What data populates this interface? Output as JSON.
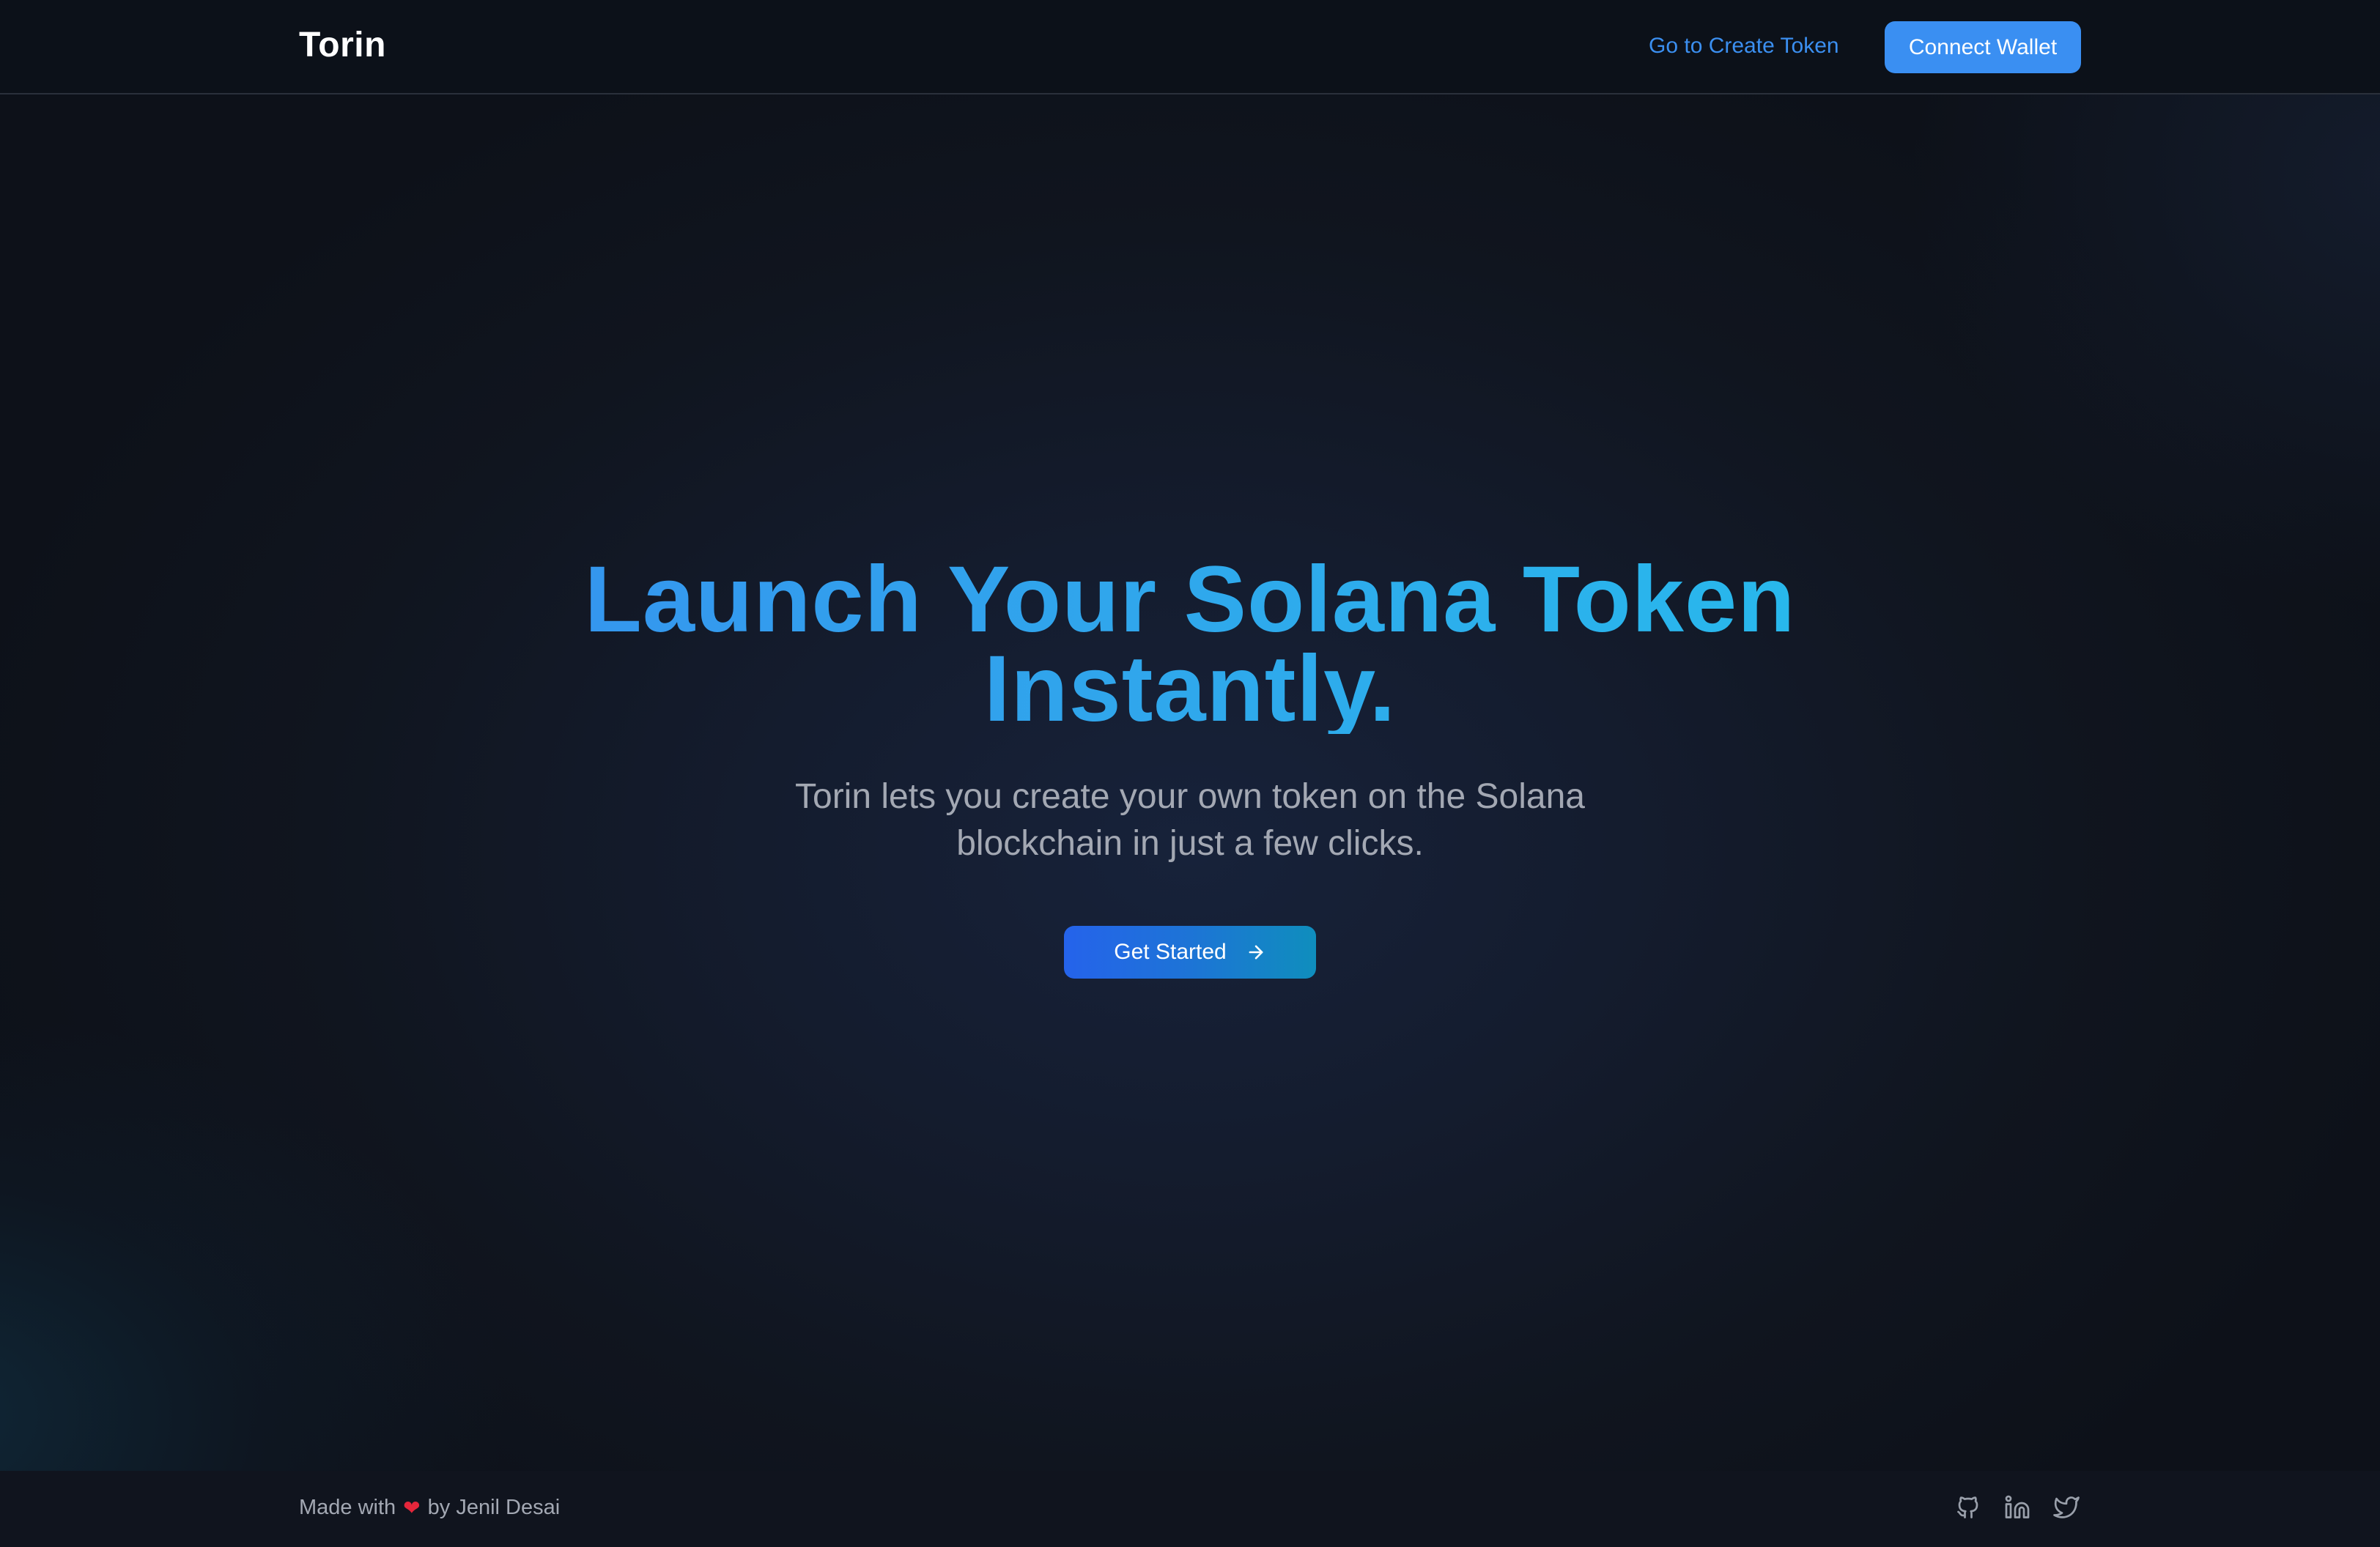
{
  "header": {
    "brand": "Torin",
    "nav_link": "Go to Create Token",
    "connect_button": "Connect Wallet"
  },
  "hero": {
    "title_line1": "Launch Your Solana Token",
    "title_line2": "Instantly.",
    "subtitle_line1": "Torin lets you create your own token on the Solana",
    "subtitle_line2": "blockchain in just a few clicks.",
    "cta_label": "Get Started"
  },
  "footer": {
    "made_with": "Made with",
    "heart": "❤",
    "by_author": "by Jenil Desai",
    "social_icons": [
      "github-icon",
      "linkedin-icon",
      "twitter-icon"
    ]
  },
  "colors": {
    "accent": "#3a8ff2",
    "gradient_start": "#3a86f0",
    "gradient_end": "#22c7ec",
    "background": "#0e1320"
  }
}
